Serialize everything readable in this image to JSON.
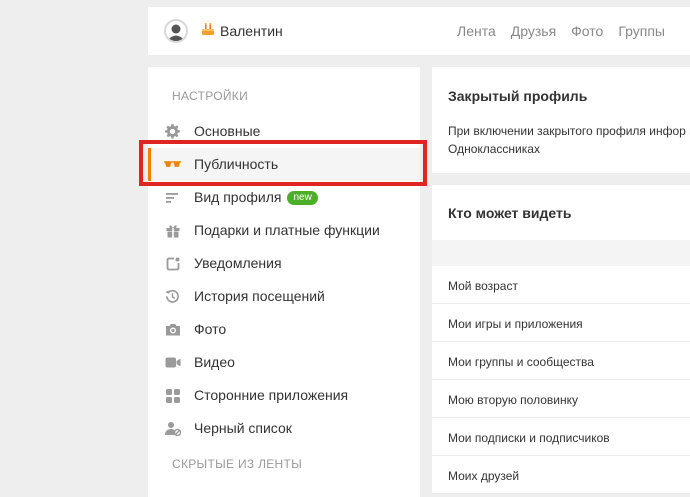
{
  "header": {
    "username": "Валентин",
    "nav": [
      "Лента",
      "Друзья",
      "Фото",
      "Группы"
    ]
  },
  "sidebar": {
    "section_title": "НАСТРОЙКИ",
    "items": [
      {
        "label": "Основные",
        "icon": "gear-icon"
      },
      {
        "label": "Публичность",
        "icon": "sunglasses-icon",
        "active": true
      },
      {
        "label": "Вид профиля",
        "icon": "lines-icon",
        "badge": "new"
      },
      {
        "label": "Подарки и платные функции",
        "icon": "gift-icon"
      },
      {
        "label": "Уведомления",
        "icon": "notification-icon"
      },
      {
        "label": "История посещений",
        "icon": "history-icon"
      },
      {
        "label": "Фото",
        "icon": "camera-icon"
      },
      {
        "label": "Видео",
        "icon": "video-icon"
      },
      {
        "label": "Сторонние приложения",
        "icon": "apps-icon"
      },
      {
        "label": "Черный список",
        "icon": "blacklist-icon"
      }
    ],
    "section2_title": "СКРЫТЫЕ ИЗ ЛЕНТЫ"
  },
  "main": {
    "closed_profile": {
      "title": "Закрытый профиль",
      "description": "При включении закрытого профиля инфор на Одноклассниках"
    },
    "who_can_see": {
      "title": "Кто может видеть",
      "rows": [
        "Мой возраст",
        "Мои игры и приложения",
        "Мои группы и сообщества",
        "Мою вторую половинку",
        "Мои подписки и подписчиков",
        "Моих друзей"
      ]
    }
  },
  "colors": {
    "accent": "#ee8208",
    "highlight": "#e02424",
    "badge": "#4caf28"
  }
}
